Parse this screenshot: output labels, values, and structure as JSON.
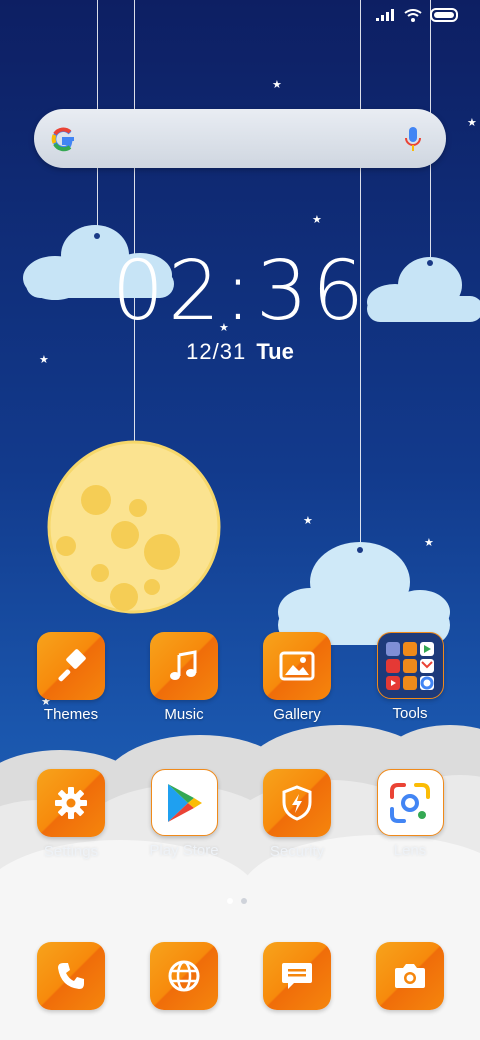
{
  "status": {
    "signal_icon": "signal-bars-icon",
    "wifi_icon": "wifi-icon",
    "battery_icon": "battery-icon"
  },
  "search": {
    "logo_icon": "google-g-icon",
    "mic_icon": "microphone-icon"
  },
  "clock": {
    "time": "02:36",
    "date": "12/31",
    "weekday": "Tue"
  },
  "apps_row1": [
    {
      "label": "Themes",
      "icon": "paintbrush-icon"
    },
    {
      "label": "Music",
      "icon": "music-note-icon"
    },
    {
      "label": "Gallery",
      "icon": "gallery-icon"
    },
    {
      "label": "Tools",
      "icon": "folder-icon"
    }
  ],
  "apps_row2": [
    {
      "label": "Settings",
      "icon": "gear-icon"
    },
    {
      "label": "Play Store",
      "icon": "play-store-icon"
    },
    {
      "label": "Security",
      "icon": "shield-bolt-icon"
    },
    {
      "label": "Lens",
      "icon": "lens-icon"
    }
  ],
  "dock": [
    {
      "icon": "phone-icon"
    },
    {
      "icon": "browser-globe-icon"
    },
    {
      "icon": "messages-icon"
    },
    {
      "icon": "camera-icon"
    }
  ],
  "page_indicator": {
    "pages": 2,
    "current": 1
  },
  "colors": {
    "accent": "#f78a0c",
    "sky_top": "#0d1f63",
    "sky_bottom": "#2a6dc0"
  }
}
